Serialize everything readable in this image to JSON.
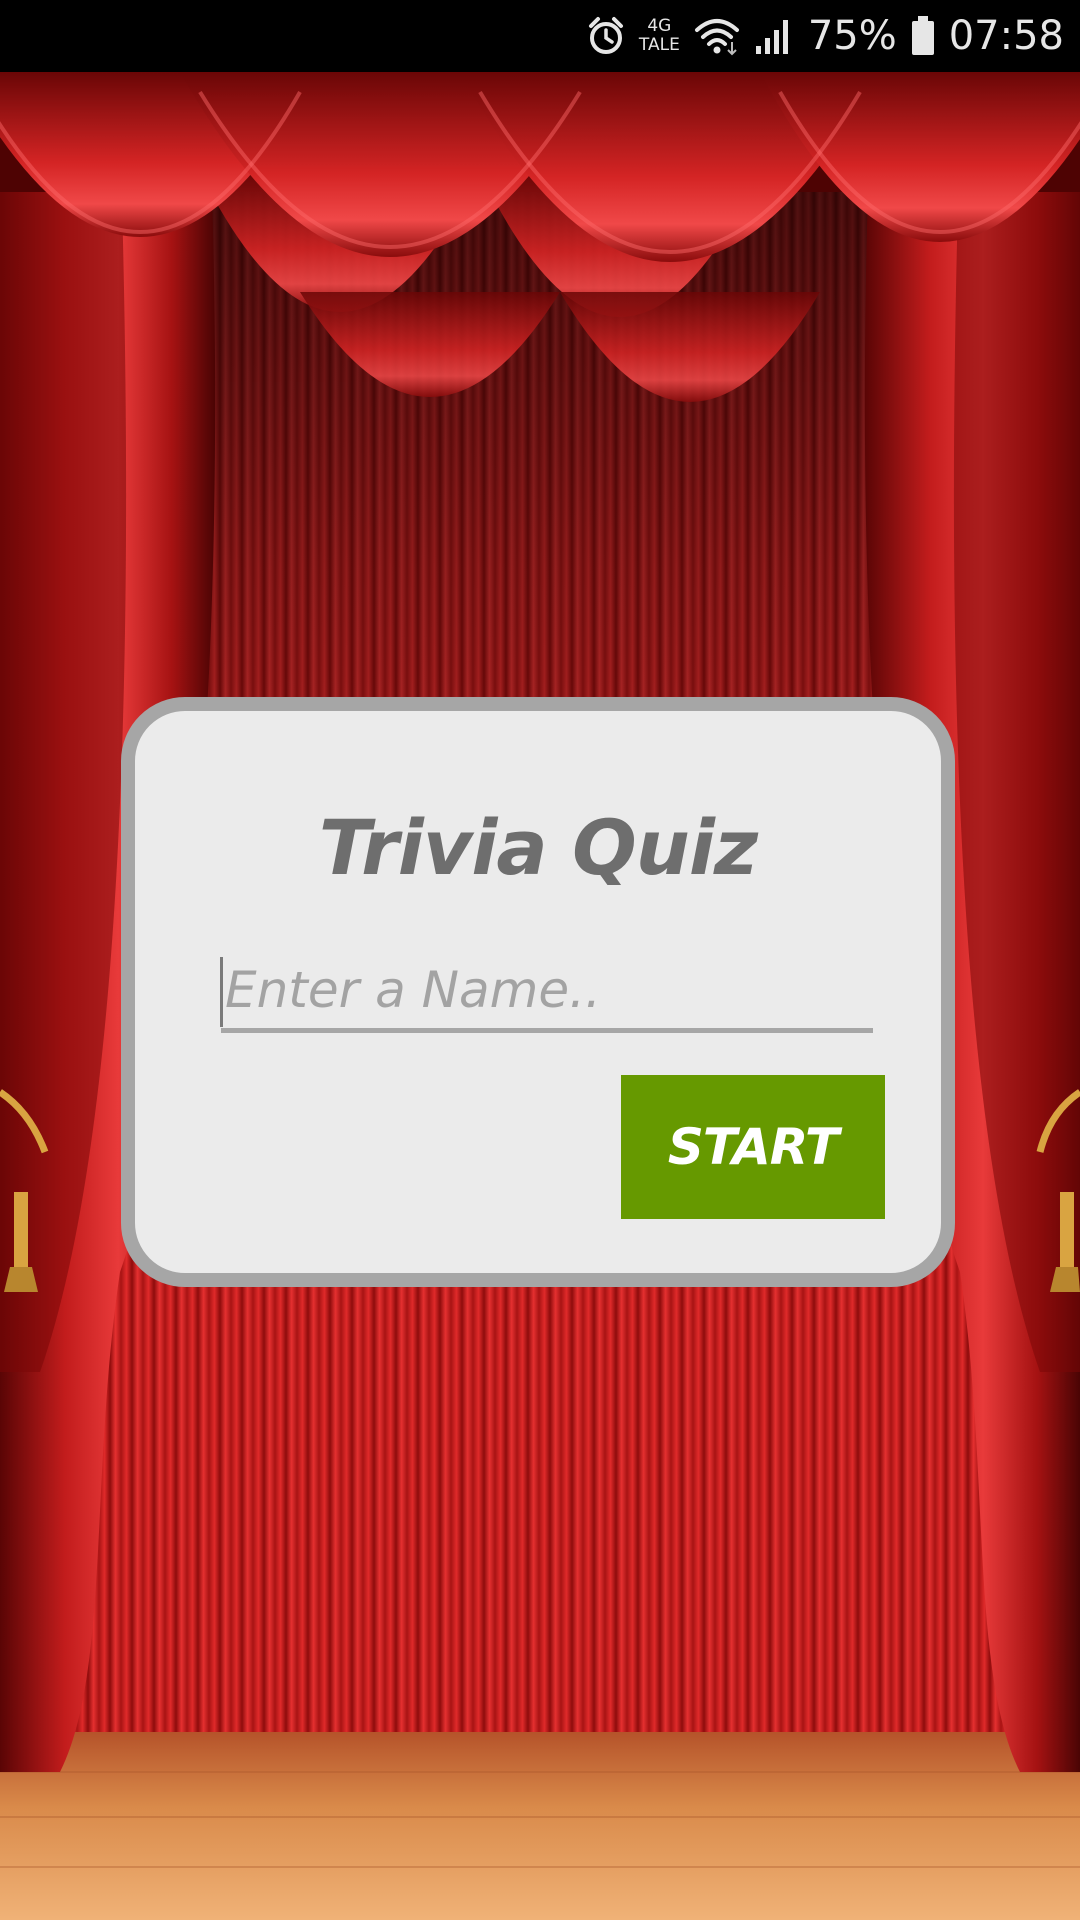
{
  "status_bar": {
    "network_top": "4G",
    "network_bottom": "TALE",
    "battery_percent": "75%",
    "time": "07:58",
    "icons": [
      "alarm-icon",
      "wifi-icon",
      "signal-icon",
      "battery-icon"
    ]
  },
  "quiz_card": {
    "title": "Trivia Quiz",
    "name_input": {
      "placeholder": "Enter a Name..",
      "value": ""
    },
    "start_label": "START"
  },
  "colors": {
    "curtain": "#c81e1e",
    "card_background": "#ebebeb",
    "card_border": "#a6a6a6",
    "title_text": "#6e6e6e",
    "start_button": "#669900",
    "floor": "#d98a4a"
  }
}
